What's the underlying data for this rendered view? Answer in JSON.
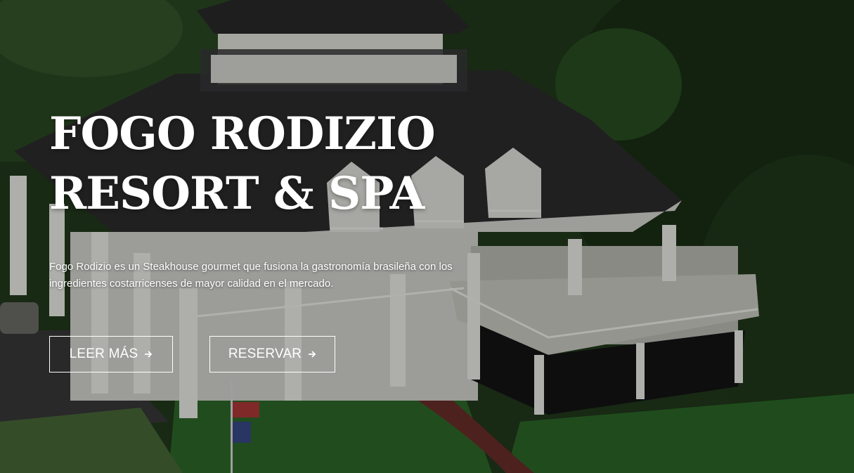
{
  "hero": {
    "title_line1": "FOGO RODIZIO",
    "title_line2": "RESORT & SPA",
    "description_line1": "Fogo Rodizio es un Steakhouse gourmet que fusiona la gastronomía brasileña con los",
    "description_line2": "ingredientes costarricenses de mayor calidad en el mercado.",
    "buttons": {
      "read_more_label": "LEER MÁS",
      "reserve_label": "RESERVAR",
      "arrow_icon": "arrow-right-icon"
    },
    "background_image": "aerial-photo-of-white-colonial-resort-building"
  },
  "colors": {
    "text": "#ffffff",
    "button_border": "#ffffff",
    "overlay": "rgba(0,0,0,0.28)"
  }
}
